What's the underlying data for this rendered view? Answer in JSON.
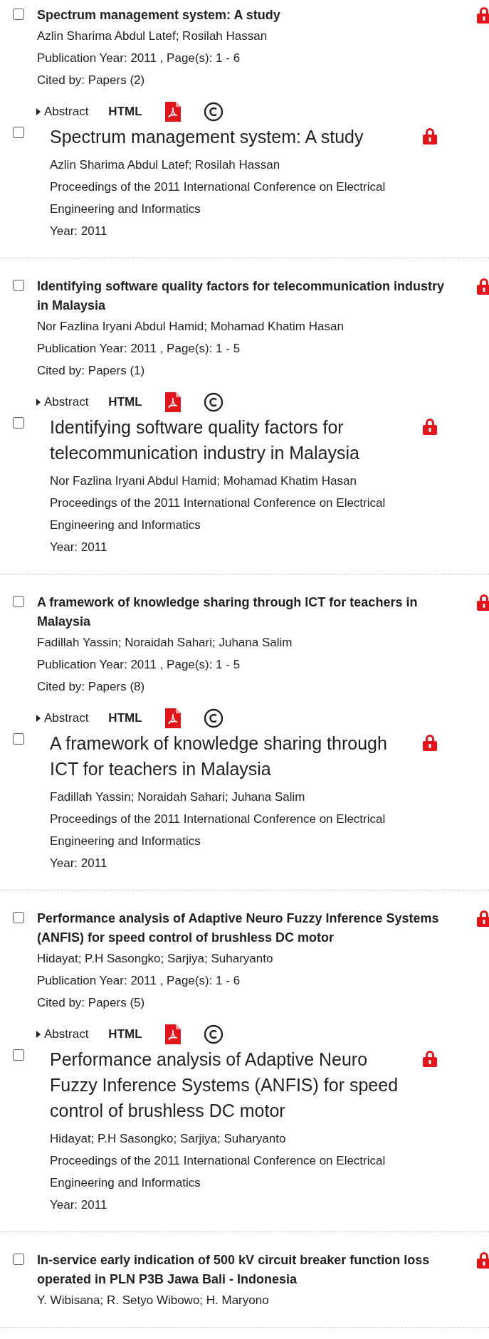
{
  "records": [
    {
      "checked": false,
      "title": "Spectrum management system: A study",
      "authors": "Azlin Sharima Abdul Latef; Rosilah Hassan",
      "publication": "Publication Year: 2011 , Page(s): 1  -  6",
      "cited_by": "Cited by: Papers (2)",
      "actions": {
        "abstract": "Abstract",
        "html": "HTML"
      },
      "detail": {
        "checked": false,
        "title": "Spectrum management system: A study",
        "authors": "Azlin Sharima Abdul Latef; Rosilah Hassan",
        "venue": "Proceedings of the 2011 International Conference on Electrical Engineering and Informatics",
        "year": "Year: 2011"
      }
    },
    {
      "checked": false,
      "title": "Identifying software quality factors for telecommunication industry in Malaysia",
      "authors": "Nor Fazlina Iryani Abdul Hamid; Mohamad Khatim Hasan",
      "publication": "Publication Year: 2011 , Page(s): 1  -  5",
      "cited_by": "Cited by: Papers (1)",
      "actions": {
        "abstract": "Abstract",
        "html": "HTML"
      },
      "detail": {
        "checked": false,
        "title": "Identifying software quality factors for telecommunication industry in Malaysia",
        "authors": "Nor Fazlina Iryani Abdul Hamid; Mohamad Khatim Hasan",
        "venue": "Proceedings of the 2011 International Conference on Electrical Engineering and Informatics",
        "year": "Year: 2011"
      }
    },
    {
      "checked": false,
      "title": "A framework of knowledge sharing through ICT for teachers in Malaysia",
      "authors": "Fadillah Yassin; Noraidah Sahari; Juhana Salim",
      "publication": "Publication Year: 2011 , Page(s): 1  -  5",
      "cited_by": "Cited by: Papers (8)",
      "actions": {
        "abstract": "Abstract",
        "html": "HTML"
      },
      "detail": {
        "checked": false,
        "title": "A framework of knowledge sharing through ICT for teachers in Malaysia",
        "authors": "Fadillah Yassin; Noraidah Sahari; Juhana Salim",
        "venue": "Proceedings of the 2011 International Conference on Electrical Engineering and Informatics",
        "year": "Year: 2011"
      }
    },
    {
      "checked": false,
      "title": "Performance analysis of Adaptive Neuro Fuzzy Inference Systems (ANFIS) for speed control of brushless DC motor",
      "authors": "Hidayat; P.H Sasongko; Sarjiya; Suharyanto",
      "publication": "Publication Year: 2011 , Page(s): 1  -  6",
      "cited_by": "Cited by: Papers (5)",
      "actions": {
        "abstract": "Abstract",
        "html": "HTML"
      },
      "detail": {
        "checked": false,
        "title": "Performance analysis of Adaptive Neuro Fuzzy Inference Systems (ANFIS) for speed control of brushless DC motor",
        "authors": "Hidayat; P.H Sasongko; Sarjiya; Suharyanto",
        "venue": "Proceedings of the 2011 International Conference on Electrical Engineering and Informatics",
        "year": "Year: 2011"
      }
    },
    {
      "checked": false,
      "title": "In-service early indication of 500 kV circuit breaker function loss operated in PLN P3B Jawa Bali - Indonesia",
      "authors": "Y. Wibisana; R. Setyo Wibowo; H. Maryono"
    }
  ]
}
